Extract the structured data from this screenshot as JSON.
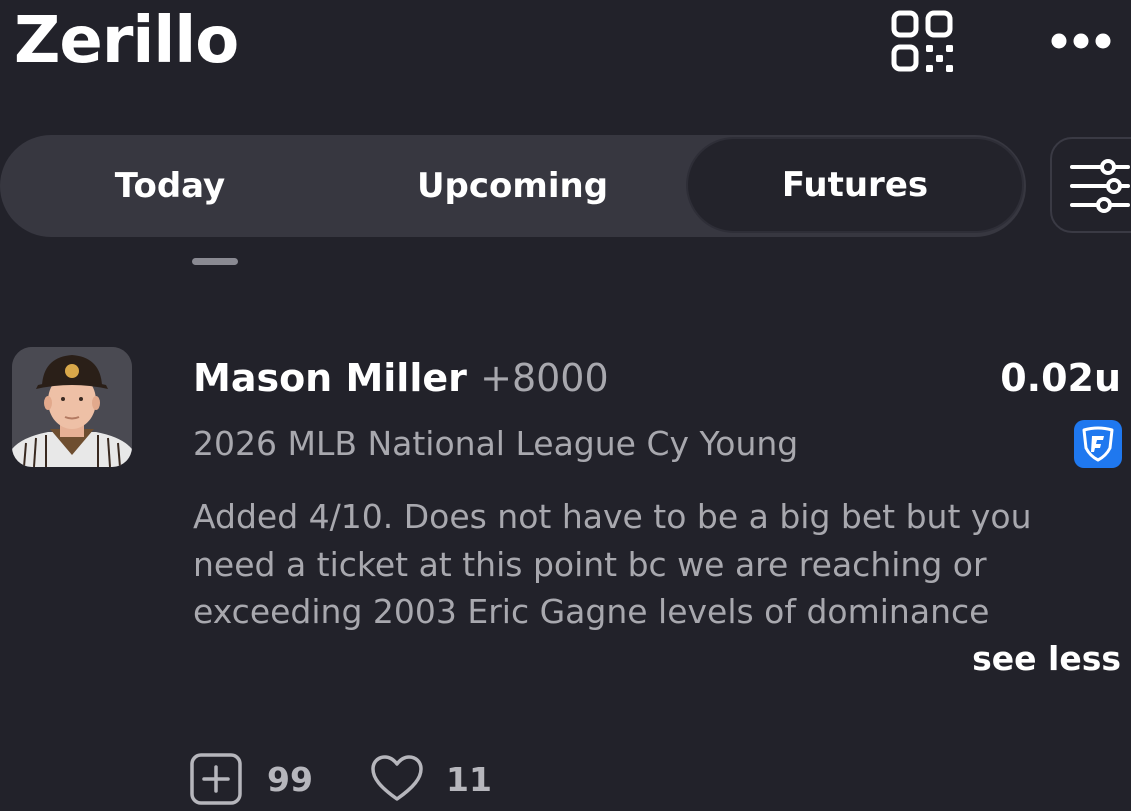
{
  "header": {
    "title": "Zerillo",
    "qr_icon": "qr-code-icon",
    "more_icon": "more-horizontal-icon"
  },
  "tabs": [
    {
      "label": "Today",
      "selected": false
    },
    {
      "label": "Upcoming",
      "selected": false
    },
    {
      "label": "Futures",
      "selected": true
    }
  ],
  "filter_icon": "sliders-icon",
  "pick": {
    "avatar_icon": "player-headshot",
    "player": "Mason Miller",
    "odds": "+8000",
    "units": "0.02u",
    "market": "2026 MLB National League Cy Young",
    "sportsbook_icon": "fanduel-shield-icon",
    "note": "Added 4/10. Does not have to be a big bet but you need a ticket at this point bc we are reaching or exceeding 2003 Eric Gagne levels of dominance",
    "see_less": "see less"
  },
  "actions": {
    "add_icon": "plus-square-icon",
    "add_count": "99",
    "like_icon": "heart-icon",
    "like_count": "11"
  },
  "colors": {
    "background": "#22222a",
    "tab_bar": "#373740",
    "muted_text": "#a8a8ae",
    "sportsbook_blue": "#1f78ef"
  }
}
